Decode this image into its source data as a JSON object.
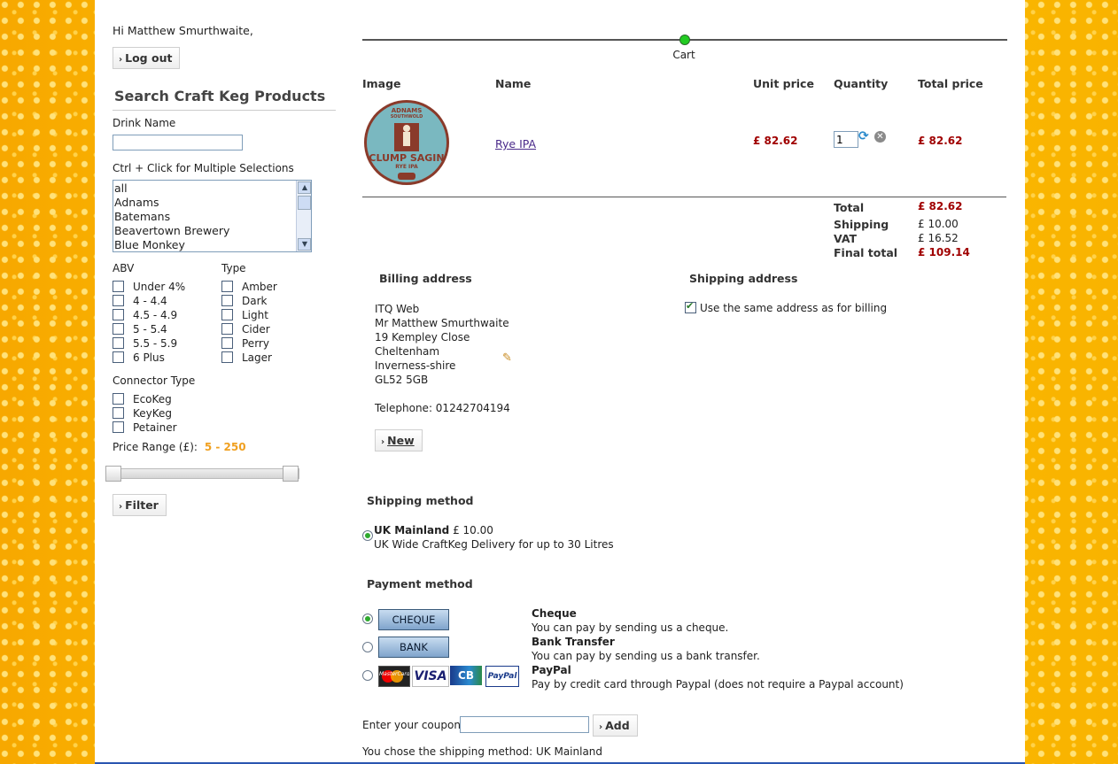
{
  "greeting": "Hi Matthew Smurthwaite,",
  "logout_label": "Log out",
  "search": {
    "title": "Search Craft Keg Products",
    "drink_name_label": "Drink Name",
    "drink_name_value": "",
    "multi_label": "Ctrl + Click for Multiple Selections",
    "breweries": [
      "all",
      "Adnams",
      "Batemans",
      "Beavertown Brewery",
      "Blue Monkey"
    ],
    "abv_label": "ABV",
    "abv_options": [
      "Under 4%",
      "4 - 4.4",
      "4.5 - 4.9",
      "5 - 5.4",
      "5.5 - 5.9",
      "6 Plus"
    ],
    "type_label": "Type",
    "type_options": [
      "Amber",
      "Dark",
      "Light",
      "Cider",
      "Perry",
      "Lager"
    ],
    "connector_label": "Connector Type",
    "connector_options": [
      "EcoKeg",
      "KeyKeg",
      "Petainer"
    ],
    "price_label": "Price Range (£):",
    "price_value": "5 - 250",
    "filter_label": "Filter"
  },
  "progress": {
    "step_label": "Cart"
  },
  "cart": {
    "headers": {
      "image": "Image",
      "name": "Name",
      "unit_price": "Unit price",
      "quantity": "Quantity",
      "total_price": "Total price"
    },
    "item": {
      "name": "Rye IPA",
      "unit_price": "£ 82.62",
      "quantity": "1",
      "total_price": "£ 82.62",
      "badge": {
        "top": "ADNAMS",
        "sub": "SOUTHWOLD",
        "main": "CLUMP SAGIN",
        "beer": "RYE IPA"
      }
    },
    "totals": [
      {
        "label": "Total",
        "value": "£ 82.62",
        "highlight": true
      },
      {
        "label": "Shipping",
        "value": "£ 10.00",
        "highlight": false
      },
      {
        "label": "VAT",
        "value": "£ 16.52",
        "highlight": false
      },
      {
        "label": "Final total",
        "value": "£ 109.14",
        "highlight": true
      }
    ]
  },
  "billing": {
    "title": "Billing address",
    "lines": [
      "ITQ Web",
      "Mr Matthew Smurthwaite",
      "19 Kempley Close",
      "Cheltenham",
      "Inverness-shire",
      "GL52 5GB"
    ],
    "telephone": "Telephone: 01242704194",
    "new_label": "New"
  },
  "shipping_address": {
    "title": "Shipping address",
    "same_label": "Use the same address as for billing",
    "same_checked": true
  },
  "shipping_method": {
    "title": "Shipping method",
    "name": "UK Mainland",
    "price": "£ 10.00",
    "description": "UK Wide CraftKeg Delivery for up to 30 Litres"
  },
  "payment_method": {
    "title": "Payment method",
    "options": [
      {
        "button": "CHEQUE",
        "name": "Cheque",
        "description": "You can pay by sending us a cheque.",
        "selected": true
      },
      {
        "button": "BANK",
        "name": "Bank Transfer",
        "description": "You can pay by sending us a bank transfer.",
        "selected": false
      },
      {
        "button": "",
        "name": "PayPal",
        "description": "Pay by credit card through Paypal (does not require a Paypal account)",
        "selected": false
      }
    ],
    "card_logos": [
      "MasterCard",
      "VISA",
      "CB",
      "PayPal"
    ]
  },
  "coupon": {
    "label": "Enter your coupon",
    "value": "",
    "add_label": "Add"
  },
  "chosen_shipping": "You chose the shipping method: UK Mainland",
  "colors": {
    "price_red": "#a00000",
    "accent_orange": "#f0a020",
    "progress_green": "#22cc22"
  }
}
